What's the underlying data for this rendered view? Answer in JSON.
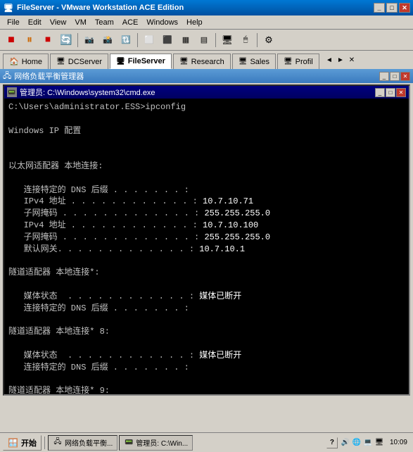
{
  "window": {
    "title": "FileServer - VMware Workstation ACE Edition",
    "title_icon": "🖥",
    "controls": {
      "minimize": "_",
      "maximize": "□",
      "close": "✕"
    }
  },
  "menu": {
    "items": [
      "File",
      "Edit",
      "View",
      "VM",
      "Team",
      "ACE",
      "Windows",
      "Help"
    ]
  },
  "toolbar": {
    "buttons": [
      "▶",
      "⏸",
      "⏹",
      "🔄",
      "📷",
      "📸",
      "🔃",
      "⬛",
      "📂",
      "📄",
      "📋",
      "🖥",
      "🖱",
      "⚙"
    ]
  },
  "tabs": {
    "items": [
      {
        "label": "Home",
        "active": false
      },
      {
        "label": "DCServer",
        "active": false
      },
      {
        "label": "FileServer",
        "active": true
      },
      {
        "label": "Research",
        "active": false
      },
      {
        "label": "Sales",
        "active": false
      },
      {
        "label": "Profil",
        "active": false
      }
    ],
    "arrow_left": "◄",
    "arrow_right": "►",
    "arrow_close": "✕"
  },
  "sub_window": {
    "title": "网络负载平衡管理器",
    "controls": {
      "minimize": "_",
      "maximize": "□",
      "close": "✕"
    }
  },
  "cmd_window": {
    "title": "管理员: C:\\Windows\\system32\\cmd.exe",
    "controls": {
      "minimize": "_",
      "maximize": "□",
      "close": "✕"
    }
  },
  "cmd_content": {
    "prompt": "C:\\Users\\administrator.ESS>ipconfig",
    "output_lines": [
      "",
      "Windows IP 配置",
      "",
      "",
      "以太网适配器 本地连接:",
      "",
      "   连接特定的 DNS 后缀 . . . . . . . :",
      "   IPv4 地址 . . . . . . . . . . . . : 10.7.10.71",
      "   子网掩码 . . . . . . . . . . . . . : 255.255.255.0",
      "   IPv4 地址 . . . . . . . . . . . . : 10.7.10.100",
      "   子网掩码 . . . . . . . . . . . . . : 255.255.255.0",
      "   默认网关. . . . . . . . . . . . . : 10.7.10.1",
      "",
      "隧道适配器 本地连接*:",
      "",
      "   媒体状态  . . . . . . . . . . . . : 媒体已断开",
      "   连接特定的 DNS 后缀 . . . . . . . :",
      "",
      "隧道适配器 本地连接* 8:",
      "",
      "   媒体状态  . . . . . . . . . . . . : 媒体已断开",
      "   连接特定的 DNS 后缀 . . . . . . . :",
      "",
      "隧道适配器 本地连接* 9:"
    ]
  },
  "statusbar": {
    "start_label": "开始",
    "start_icon": "🪟",
    "tasks": [
      {
        "label": "网络负载平衡...",
        "icon": "🖧"
      },
      {
        "label": "管理员: C:\\Win...",
        "icon": "📟"
      }
    ],
    "help_label": "?",
    "tray_icons": [
      "🔊",
      "🌐",
      "💻",
      "🖥"
    ],
    "clock": "10:09"
  }
}
